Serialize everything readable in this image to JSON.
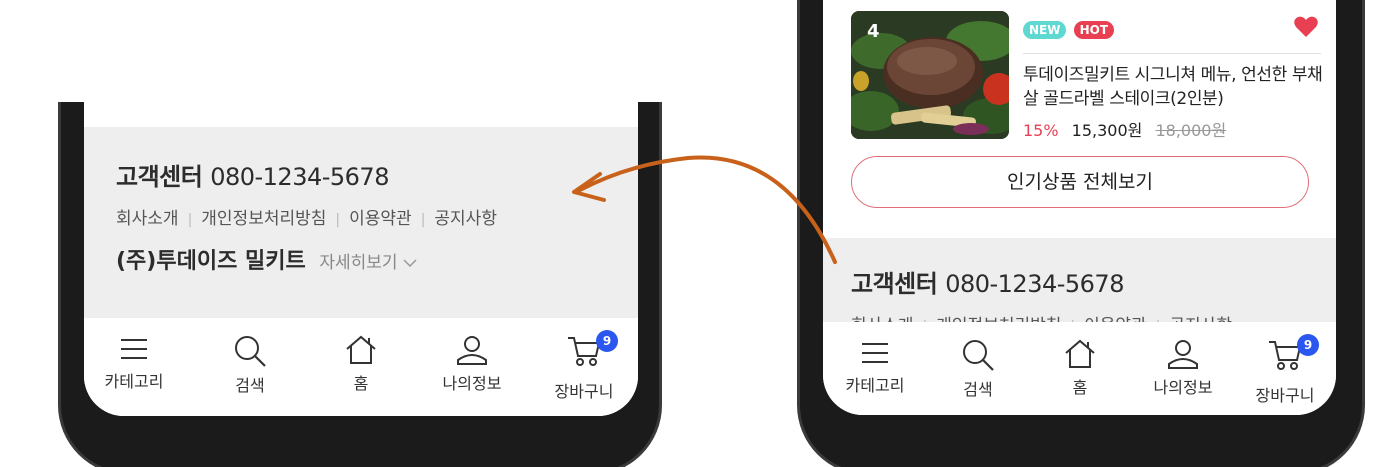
{
  "left_screen": {
    "customer_center": "고객센터",
    "phone": "080-1234-5678",
    "links": [
      "회사소개",
      "개인정보처리방침",
      "이용약관",
      "공지사항"
    ],
    "company_name": "(주)투데이즈 밀키트",
    "detail_label": "자세히보기"
  },
  "right_screen": {
    "product": {
      "rank": "4",
      "badge_new": "NEW",
      "badge_hot": "HOT",
      "name": "투데이즈밀키트 시그니쳐 메뉴, 언선한 부채살 골드라벨 스테이크(2인분)",
      "discount": "15%",
      "price": "15,300원",
      "original_price": "18,000원"
    },
    "view_all": "인기상품 전체보기",
    "customer_center": "고객센터",
    "phone": "080-1234-5678",
    "links": [
      "회사소개",
      "개인정보처리방침",
      "이용약관",
      "공지사항"
    ]
  },
  "tabbar": {
    "items": [
      {
        "label": "카테고리",
        "icon": "menu-icon"
      },
      {
        "label": "검색",
        "icon": "search-icon"
      },
      {
        "label": "홈",
        "icon": "home-icon"
      },
      {
        "label": "나의정보",
        "icon": "user-icon"
      },
      {
        "label": "장바구니",
        "icon": "cart-icon"
      }
    ],
    "cart_count": "9"
  },
  "colors": {
    "accent_red": "#e84052",
    "badge_new": "#5fd8d2",
    "cart_badge": "#2b57f0",
    "arrow": "#c8621b",
    "footer_bg": "#eeeeee"
  }
}
